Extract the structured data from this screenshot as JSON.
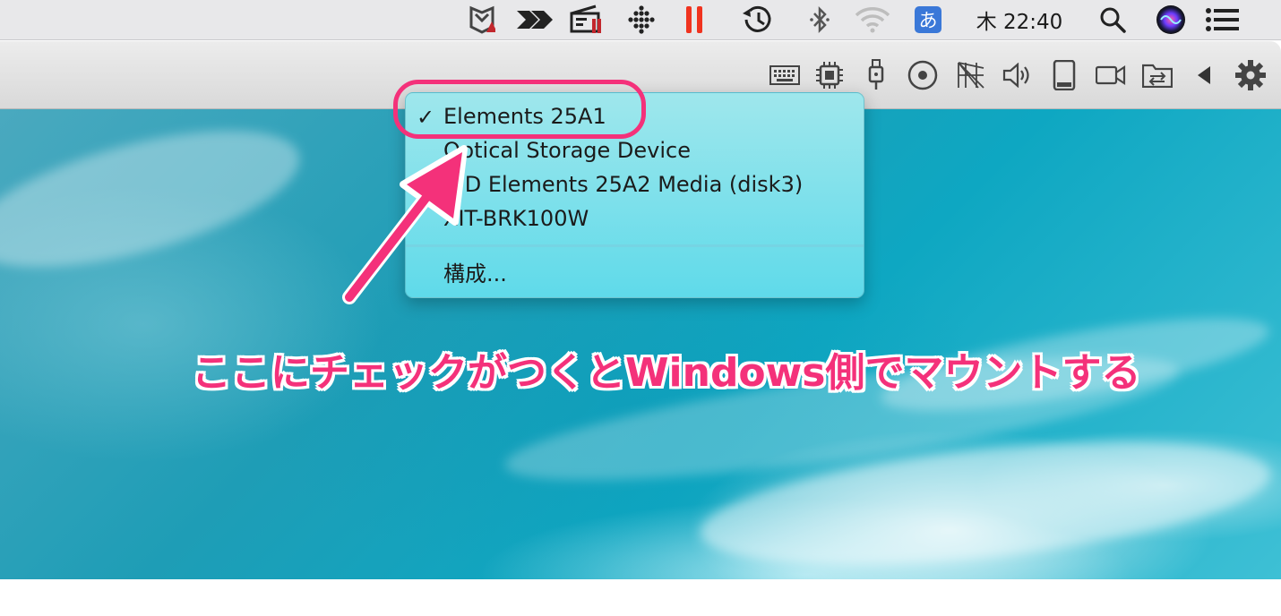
{
  "menubar": {
    "icons": [
      "mcafee-icon",
      "arrow-app-icon",
      "clapper-icon",
      "fitbit-icon",
      "parallels-pause-icon",
      "time-machine-icon",
      "bluetooth-icon",
      "wifi-icon"
    ],
    "ime_label": "あ",
    "clock": "木 22:40",
    "right_icons": [
      "spotlight-icon",
      "siri-icon",
      "notification-center-icon"
    ],
    "colors": {
      "pause": "#f0331f",
      "ime": "#3a78d8"
    }
  },
  "toolbar": {
    "icons": [
      "keyboard-icon",
      "cpu-icon",
      "usb-icon",
      "cd-icon",
      "network-icon",
      "sound-icon",
      "storage-icon",
      "camera-icon",
      "shared-folder-icon",
      "collapse-icon",
      "settings-icon"
    ]
  },
  "menu": {
    "items": [
      {
        "label": "Elements 25A1",
        "checked": true
      },
      {
        "label": "Optical Storage Device",
        "checked": false
      },
      {
        "label": "WD Elements 25A2 Media (disk3)",
        "checked": false
      },
      {
        "label": "XIT-BRK100W",
        "checked": false
      }
    ],
    "check_mark": "✓",
    "configure_label": "構成..."
  },
  "annotation": {
    "caption": "ここにチェックがつくとWindows側でマウントする",
    "color": "#f4317a"
  }
}
